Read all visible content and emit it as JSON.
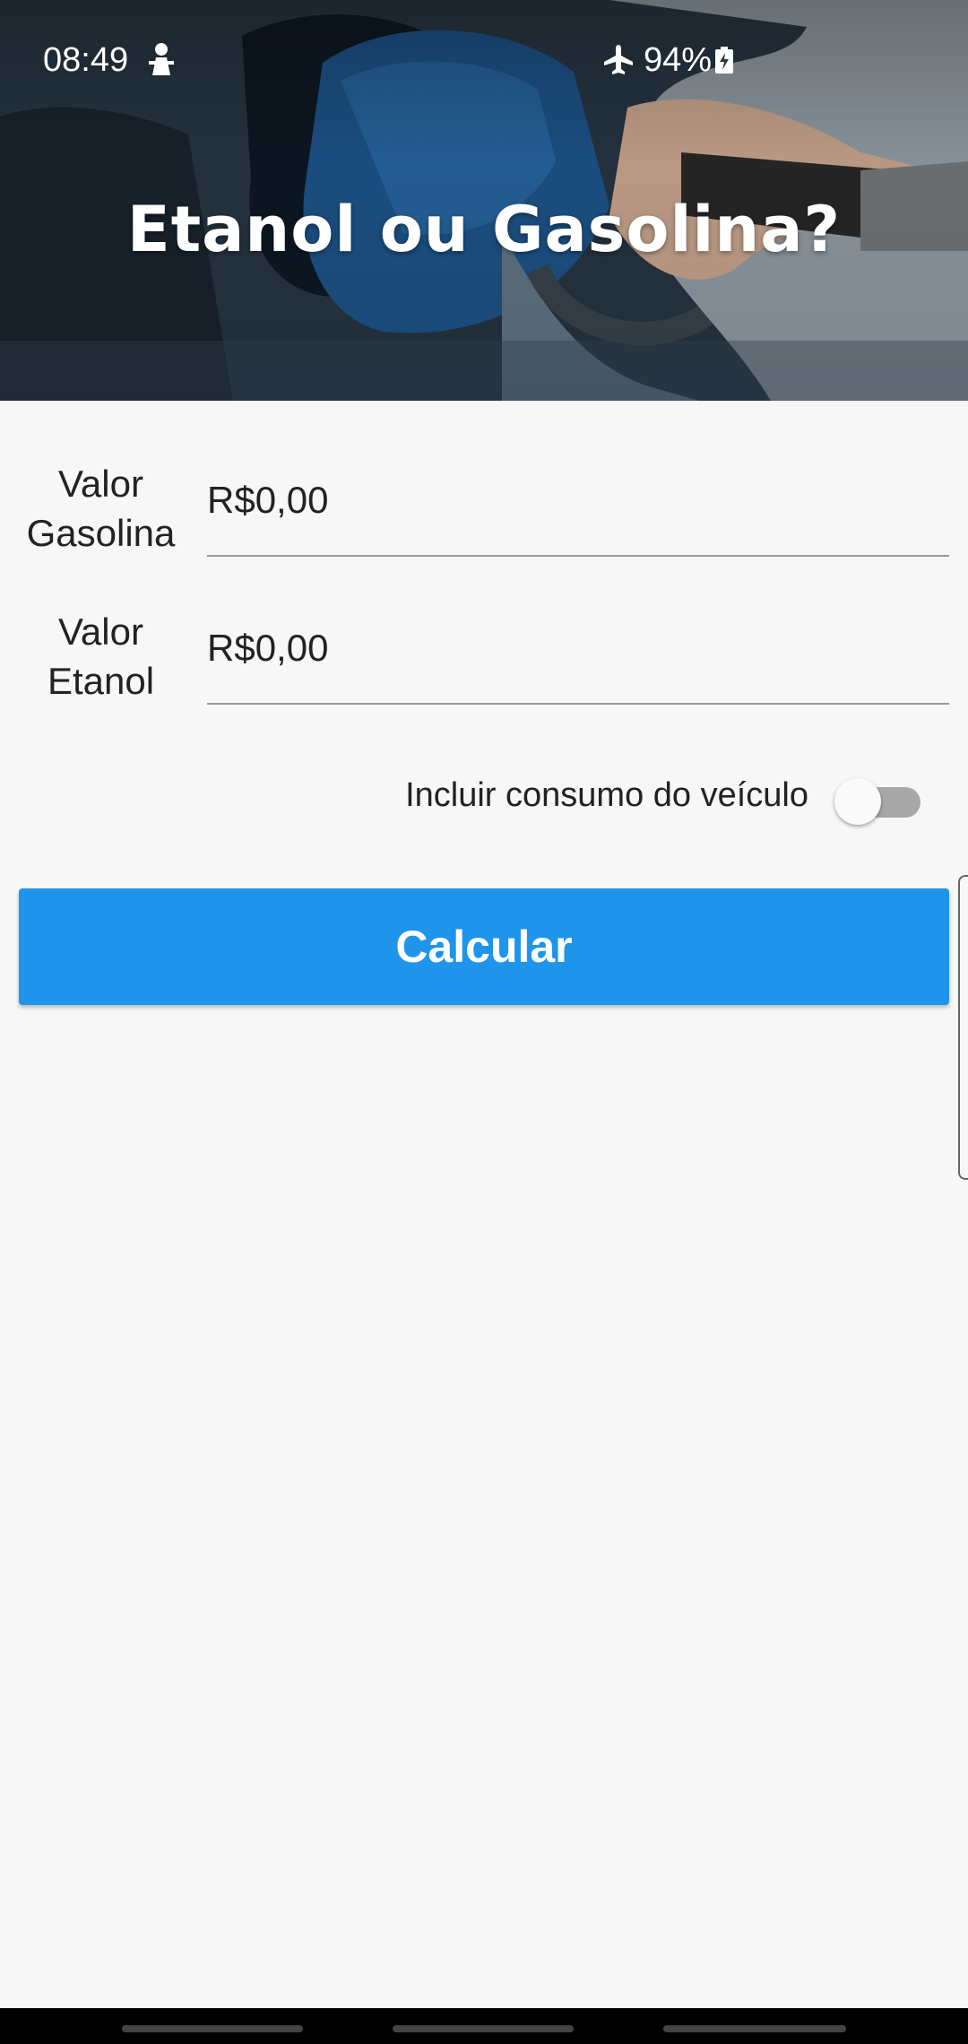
{
  "status_bar": {
    "time": "08:49",
    "battery": "94%",
    "icons": [
      "notification-icon",
      "airplane-mode-icon",
      "battery-charging-icon"
    ]
  },
  "header": {
    "title": "Etanol ou Gasolina?"
  },
  "form": {
    "gasolina": {
      "label_line1": "Valor",
      "label_line2": "Gasolina",
      "value": "R$0,00"
    },
    "etanol": {
      "label_line1": "Valor",
      "label_line2": "Etanol",
      "value": "R$0,00"
    },
    "toggle": {
      "label": "Incluir consumo do veículo",
      "checked": false
    }
  },
  "actions": {
    "calculate_label": "Calcular"
  },
  "colors": {
    "accent": "#1e95ea",
    "background": "#f7f7f7",
    "text": "#222222",
    "underline": "#9a9a9a",
    "switch_track": "#a8a8a8"
  }
}
